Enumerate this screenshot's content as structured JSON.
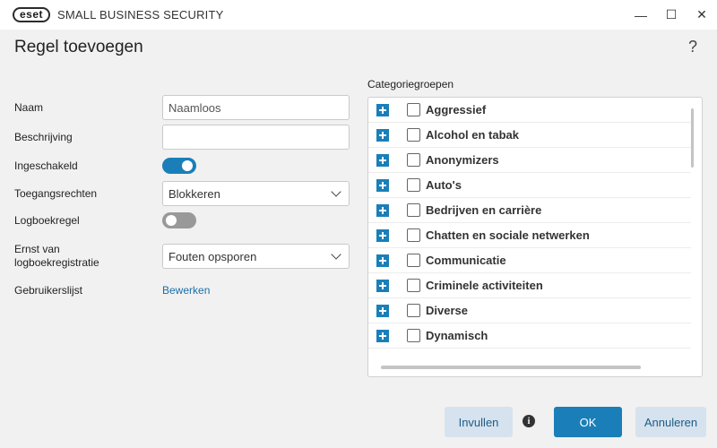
{
  "titlebar": {
    "logo": "eset",
    "app_title": "SMALL BUSINESS SECURITY",
    "minimize": "—",
    "maximize": "☐",
    "close": "✕"
  },
  "dialog": {
    "title": "Regel toevoegen",
    "help": "?"
  },
  "form": {
    "name_label": "Naam",
    "name_value": "Naamloos",
    "description_label": "Beschrijving",
    "description_value": "",
    "enabled_label": "Ingeschakeld",
    "enabled": true,
    "access_label": "Toegangsrechten",
    "access_value": "Blokkeren",
    "log_rule_label": "Logboekregel",
    "log_rule": false,
    "severity_label": "Ernst van logboekregistratie",
    "severity_value": "Fouten opsporen",
    "userlist_label": "Gebruikerslijst",
    "userlist_link": "Bewerken"
  },
  "categories": {
    "label": "Categoriegroepen",
    "items": [
      {
        "label": "Aggressief",
        "checked": false
      },
      {
        "label": "Alcohol en tabak",
        "checked": false
      },
      {
        "label": "Anonymizers",
        "checked": false
      },
      {
        "label": "Auto's",
        "checked": false
      },
      {
        "label": "Bedrijven en carrière",
        "checked": false
      },
      {
        "label": "Chatten en sociale netwerken",
        "checked": false
      },
      {
        "label": "Communicatie",
        "checked": false
      },
      {
        "label": "Criminele activiteiten",
        "checked": false
      },
      {
        "label": "Diverse",
        "checked": false
      },
      {
        "label": "Dynamisch",
        "checked": false
      }
    ]
  },
  "footer": {
    "fill_button": "Invullen",
    "info": "i",
    "ok_button": "OK",
    "cancel_button": "Annuleren"
  },
  "colors": {
    "accent": "#1a7fb8",
    "secondary_button": "#d6e3ee",
    "link": "#1a6fa8"
  }
}
